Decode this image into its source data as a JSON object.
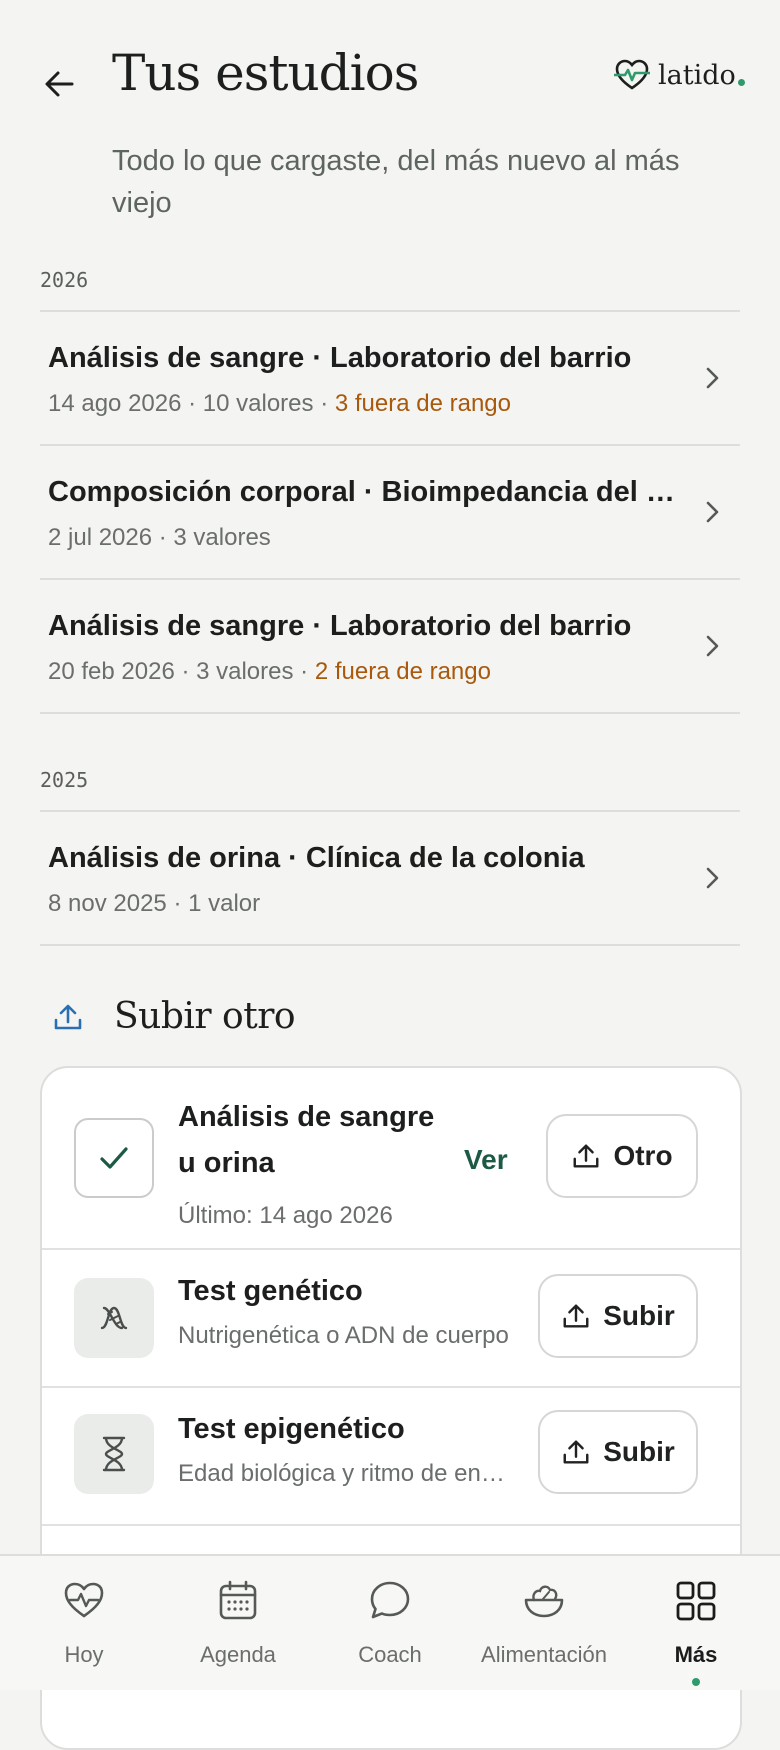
{
  "header": {
    "title": "Tus estudios",
    "subtitle": "Todo lo que cargaste, del más nuevo al más viejo",
    "logo_text": "latido",
    "back_icon": "arrow-left-icon",
    "accent_color": "#2f9a6b"
  },
  "years": [
    {
      "label": "2026",
      "items": [
        {
          "name": "Análisis de sangre · Laboratorio del barrio",
          "meta": "14 ago 2026 · 10 valores · ",
          "warn": "3 fuera de rango"
        },
        {
          "name": "Composición corporal · Bioimpedancia del gimnasio",
          "meta": "2 jul 2026 · 3 valores",
          "warn": ""
        },
        {
          "name": "Análisis de sangre · Laboratorio del barrio",
          "meta": "20 feb 2026 · 3 valores · ",
          "warn": "2 fuera de rango"
        }
      ]
    },
    {
      "label": "2025",
      "items": [
        {
          "name": "Análisis de orina · Clínica de la colonia",
          "meta": "8 nov 2025 · 1 valor",
          "warn": ""
        }
      ]
    }
  ],
  "upload": {
    "title": "Subir otro",
    "rows": [
      {
        "name_line1": "Análisis de sangre",
        "name_line2": "u orina",
        "sub": "Último: 14 ago 2026",
        "link": "Ver",
        "button": "Otro",
        "icon": "check-icon"
      },
      {
        "name": "Test genético",
        "sub": "Nutrigenética o ADN de cuerpo",
        "button": "Subir",
        "icon": "dna-icon"
      },
      {
        "name": "Test epigenético",
        "sub": "Edad biológica y ritmo de envejecimiento",
        "button": "Subir",
        "icon": "hourglass-icon"
      }
    ]
  },
  "nav": {
    "items": [
      {
        "label": "Hoy",
        "icon": "heart-pulse-icon"
      },
      {
        "label": "Agenda",
        "icon": "calendar-icon"
      },
      {
        "label": "Coach",
        "icon": "chat-bubble-icon"
      },
      {
        "label": "Alimentación",
        "icon": "salad-bowl-icon"
      },
      {
        "label": "Más",
        "icon": "grid-icon",
        "active": true
      }
    ]
  }
}
